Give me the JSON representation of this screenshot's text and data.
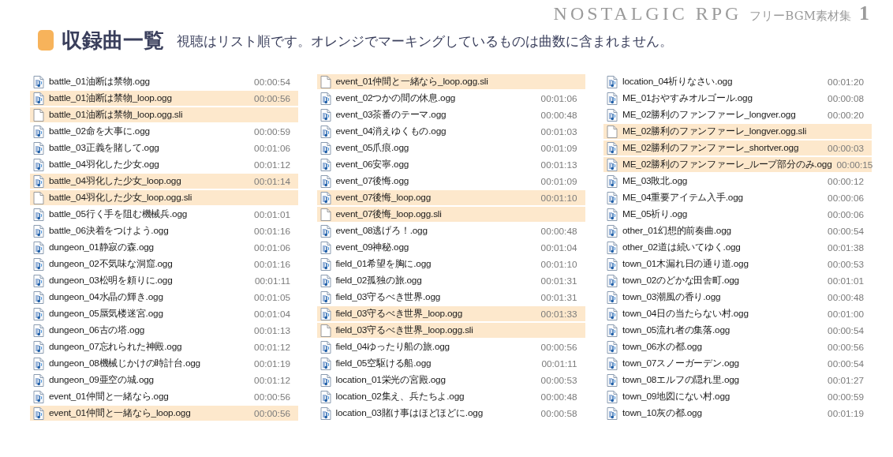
{
  "logo": {
    "title": "NOSTALGIC RPG",
    "subtitle": "フリーBGM素材集",
    "volume": "1"
  },
  "header": {
    "title": "収録曲一覧",
    "note": "視聴はリスト順です。オレンジでマーキングしているものは曲数に含まれません。"
  },
  "columns": [
    {
      "items": [
        {
          "name": "battle_01油断は禁物.ogg",
          "kind": "audio",
          "duration": "00:00:54",
          "marked": false
        },
        {
          "name": "battle_01油断は禁物_loop.ogg",
          "kind": "audio",
          "duration": "00:00:56",
          "marked": true
        },
        {
          "name": "battle_01油断は禁物_loop.ogg.sli",
          "kind": "sli",
          "marked": true
        },
        {
          "name": "battle_02命を大事に.ogg",
          "kind": "audio",
          "duration": "00:00:59",
          "marked": false
        },
        {
          "name": "battle_03正義を賭して.ogg",
          "kind": "audio",
          "duration": "00:01:06",
          "marked": false
        },
        {
          "name": "battle_04羽化した少女.ogg",
          "kind": "audio",
          "duration": "00:01:12",
          "marked": false
        },
        {
          "name": "battle_04羽化した少女_loop.ogg",
          "kind": "audio",
          "duration": "00:01:14",
          "marked": true
        },
        {
          "name": "battle_04羽化した少女_loop.ogg.sli",
          "kind": "sli",
          "marked": true
        },
        {
          "name": "battle_05行く手を阻む機械兵.ogg",
          "kind": "audio",
          "duration": "00:01:01",
          "marked": false
        },
        {
          "name": "battle_06決着をつけよう.ogg",
          "kind": "audio",
          "duration": "00:01:16",
          "marked": false
        },
        {
          "name": "dungeon_01静寂の森.ogg",
          "kind": "audio",
          "duration": "00:01:06",
          "marked": false
        },
        {
          "name": "dungeon_02不気味な洞窟.ogg",
          "kind": "audio",
          "duration": "00:01:16",
          "marked": false
        },
        {
          "name": "dungeon_03松明を頼りに.ogg",
          "kind": "audio",
          "duration": "00:01:11",
          "marked": false
        },
        {
          "name": "dungeon_04水晶の輝き.ogg",
          "kind": "audio",
          "duration": "00:01:05",
          "marked": false
        },
        {
          "name": "dungeon_05蜃気楼迷宮.ogg",
          "kind": "audio",
          "duration": "00:01:04",
          "marked": false
        },
        {
          "name": "dungeon_06古の塔.ogg",
          "kind": "audio",
          "duration": "00:01:13",
          "marked": false
        },
        {
          "name": "dungeon_07忘れられた神殿.ogg",
          "kind": "audio",
          "duration": "00:01:12",
          "marked": false
        },
        {
          "name": "dungeon_08機械じかけの時計台.ogg",
          "kind": "audio",
          "duration": "00:01:19",
          "marked": false
        },
        {
          "name": "dungeon_09亜空の城.ogg",
          "kind": "audio",
          "duration": "00:01:12",
          "marked": false
        },
        {
          "name": "event_01仲間と一緒なら.ogg",
          "kind": "audio",
          "duration": "00:00:56",
          "marked": false
        },
        {
          "name": "event_01仲間と一緒なら_loop.ogg",
          "kind": "audio",
          "duration": "00:00:56",
          "marked": true
        }
      ]
    },
    {
      "items": [
        {
          "name": "event_01仲間と一緒なら_loop.ogg.sli",
          "kind": "sli",
          "marked": true
        },
        {
          "name": "event_02つかの間の休息.ogg",
          "kind": "audio",
          "duration": "00:01:06",
          "marked": false
        },
        {
          "name": "event_03茶番のテーマ.ogg",
          "kind": "audio",
          "duration": "00:00:48",
          "marked": false
        },
        {
          "name": "event_04消えゆくもの.ogg",
          "kind": "audio",
          "duration": "00:01:03",
          "marked": false
        },
        {
          "name": "event_05爪痕.ogg",
          "kind": "audio",
          "duration": "00:01:09",
          "marked": false
        },
        {
          "name": "event_06安寧.ogg",
          "kind": "audio",
          "duration": "00:01:13",
          "marked": false
        },
        {
          "name": "event_07後悔.ogg",
          "kind": "audio",
          "duration": "00:01:09",
          "marked": false
        },
        {
          "name": "event_07後悔_loop.ogg",
          "kind": "audio",
          "duration": "00:01:10",
          "marked": true
        },
        {
          "name": "event_07後悔_loop.ogg.sli",
          "kind": "sli",
          "marked": true
        },
        {
          "name": "event_08逃げろ！.ogg",
          "kind": "audio",
          "duration": "00:00:48",
          "marked": false
        },
        {
          "name": "event_09神秘.ogg",
          "kind": "audio",
          "duration": "00:01:04",
          "marked": false
        },
        {
          "name": "field_01希望を胸に.ogg",
          "kind": "audio",
          "duration": "00:01:10",
          "marked": false
        },
        {
          "name": "field_02孤独の旅.ogg",
          "kind": "audio",
          "duration": "00:01:31",
          "marked": false
        },
        {
          "name": "field_03守るべき世界.ogg",
          "kind": "audio",
          "duration": "00:01:31",
          "marked": false
        },
        {
          "name": "field_03守るべき世界_loop.ogg",
          "kind": "audio",
          "duration": "00:01:33",
          "marked": true
        },
        {
          "name": "field_03守るべき世界_loop.ogg.sli",
          "kind": "sli",
          "marked": true
        },
        {
          "name": "field_04ゆったり船の旅.ogg",
          "kind": "audio",
          "duration": "00:00:56",
          "marked": false
        },
        {
          "name": "field_05空駆ける船.ogg",
          "kind": "audio",
          "duration": "00:01:11",
          "marked": false
        },
        {
          "name": "location_01栄光の宮殿.ogg",
          "kind": "audio",
          "duration": "00:00:53",
          "marked": false
        },
        {
          "name": "location_02集え、兵たちよ.ogg",
          "kind": "audio",
          "duration": "00:00:48",
          "marked": false
        },
        {
          "name": "location_03賭け事はほどほどに.ogg",
          "kind": "audio",
          "duration": "00:00:58",
          "marked": false
        }
      ]
    },
    {
      "items": [
        {
          "name": "location_04祈りなさい.ogg",
          "kind": "audio",
          "duration": "00:01:20",
          "marked": false
        },
        {
          "name": "ME_01おやすみオルゴール.ogg",
          "kind": "audio",
          "duration": "00:00:08",
          "marked": false
        },
        {
          "name": "ME_02勝利のファンファーレ_longver.ogg",
          "kind": "audio",
          "duration": "00:00:20",
          "marked": false
        },
        {
          "name": "ME_02勝利のファンファーレ_longver.ogg.sli",
          "kind": "sli",
          "marked": true
        },
        {
          "name": "ME_02勝利のファンファーレ_shortver.ogg",
          "kind": "audio",
          "duration": "00:00:03",
          "marked": true
        },
        {
          "name": "ME_02勝利のファンファーレ_ループ部分のみ.ogg",
          "kind": "audio",
          "duration": "00:00:15",
          "marked": true
        },
        {
          "name": "ME_03敗北.ogg",
          "kind": "audio",
          "duration": "00:00:12",
          "marked": false
        },
        {
          "name": "ME_04重要アイテム入手.ogg",
          "kind": "audio",
          "duration": "00:00:06",
          "marked": false
        },
        {
          "name": "ME_05祈り.ogg",
          "kind": "audio",
          "duration": "00:00:06",
          "marked": false
        },
        {
          "name": "other_01幻想的前奏曲.ogg",
          "kind": "audio",
          "duration": "00:00:54",
          "marked": false
        },
        {
          "name": "other_02道は続いてゆく.ogg",
          "kind": "audio",
          "duration": "00:01:38",
          "marked": false
        },
        {
          "name": "town_01木漏れ日の通り道.ogg",
          "kind": "audio",
          "duration": "00:00:53",
          "marked": false
        },
        {
          "name": "town_02のどかな田舎町.ogg",
          "kind": "audio",
          "duration": "00:01:01",
          "marked": false
        },
        {
          "name": "town_03潮風の香り.ogg",
          "kind": "audio",
          "duration": "00:00:48",
          "marked": false
        },
        {
          "name": "town_04日の当たらない村.ogg",
          "kind": "audio",
          "duration": "00:01:00",
          "marked": false
        },
        {
          "name": "town_05流れ者の集落.ogg",
          "kind": "audio",
          "duration": "00:00:54",
          "marked": false
        },
        {
          "name": "town_06水の都.ogg",
          "kind": "audio",
          "duration": "00:00:56",
          "marked": false
        },
        {
          "name": "town_07スノーガーデン.ogg",
          "kind": "audio",
          "duration": "00:00:54",
          "marked": false
        },
        {
          "name": "town_08エルフの隠れ里.ogg",
          "kind": "audio",
          "duration": "00:01:27",
          "marked": false
        },
        {
          "name": "town_09地図にない村.ogg",
          "kind": "audio",
          "duration": "00:00:59",
          "marked": false
        },
        {
          "name": "town_10灰の都.ogg",
          "kind": "audio",
          "duration": "00:01:19",
          "marked": false
        }
      ]
    }
  ]
}
